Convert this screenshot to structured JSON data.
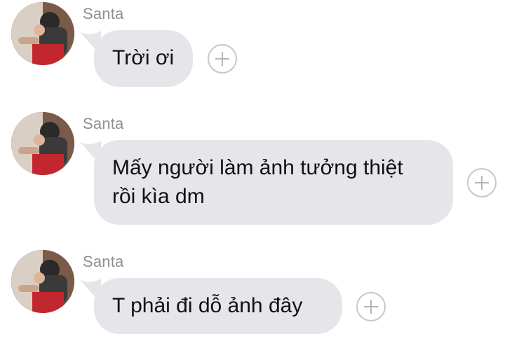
{
  "messages": [
    {
      "sender": "Santa",
      "text": "Trời ơi",
      "avatar_icon": "profile-photo"
    },
    {
      "sender": "Santa",
      "text": "Mấy người làm ảnh tưởng thiệt\nrồi kìa dm",
      "avatar_icon": "profile-photo"
    },
    {
      "sender": "Santa",
      "text": "T phải đi dỗ ảnh đây",
      "avatar_icon": "profile-photo"
    }
  ],
  "colors": {
    "bubble": "#e5e5ea",
    "sender": "#8e8e93",
    "react_border": "#c7c7cc"
  },
  "react_icon": "add-reaction-plus-icon"
}
